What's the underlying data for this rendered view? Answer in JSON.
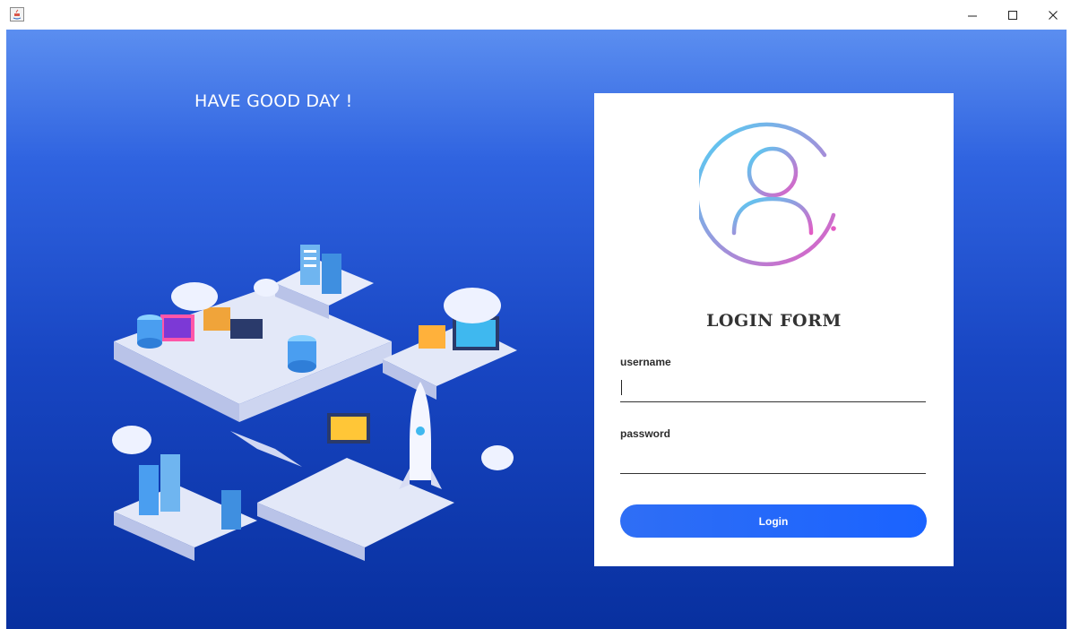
{
  "window": {
    "icons": {
      "app": "java-app-icon",
      "minimize": "minimize-icon",
      "maximize": "maximize-icon",
      "close": "close-icon"
    }
  },
  "left_panel": {
    "greeting": "HAVE GOOD DAY !",
    "illustration": "isometric-tech-city-illustration"
  },
  "login_form": {
    "avatar_icon": "user-avatar-icon",
    "title": "LOGIN FORM",
    "username_label": "username",
    "username_value": "",
    "password_label": "password",
    "password_value": "",
    "login_button": "Login"
  },
  "colors": {
    "background_top": "#5b8ef0",
    "background_bottom": "#08309f",
    "button": "#1a63ff",
    "avatar_gradient_start": "#4fd3f5",
    "avatar_gradient_end": "#e35bc4"
  }
}
